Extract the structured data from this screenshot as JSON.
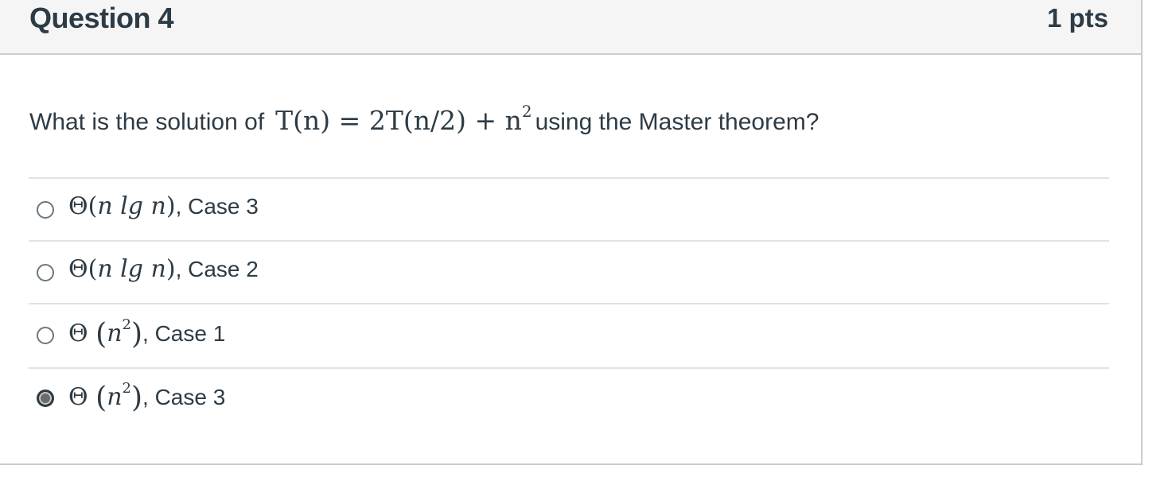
{
  "header": {
    "title": "Question 4",
    "points": "1 pts"
  },
  "question": {
    "prefix": "What is the solution of",
    "math_lhs": "T(n)",
    "math_eq": "=",
    "math_rhs_a": "2T(n/2) + n",
    "math_exp": "2",
    "suffix": "using the Master theorem?"
  },
  "answers": [
    {
      "theta": "Θ",
      "open": "(",
      "body": "n lg n",
      "exp": "",
      "close": ")",
      "case": ", Case 3",
      "selected": false
    },
    {
      "theta": "Θ",
      "open": "(",
      "body": "n lg n",
      "exp": "",
      "close": ")",
      "case": ", Case 2",
      "selected": false
    },
    {
      "theta": "Θ",
      "open": "(",
      "body": "n",
      "exp": "2",
      "close": ")",
      "case": ", Case 1",
      "selected": false
    },
    {
      "theta": "Θ",
      "open": "(",
      "body": "n",
      "exp": "2",
      "close": ")",
      "case": ", Case 3",
      "selected": true
    }
  ],
  "colors": {
    "text": "#2d3b45",
    "header_bg": "#f5f5f5",
    "border": "#c7cdd1",
    "divider": "#dfe3e6"
  }
}
